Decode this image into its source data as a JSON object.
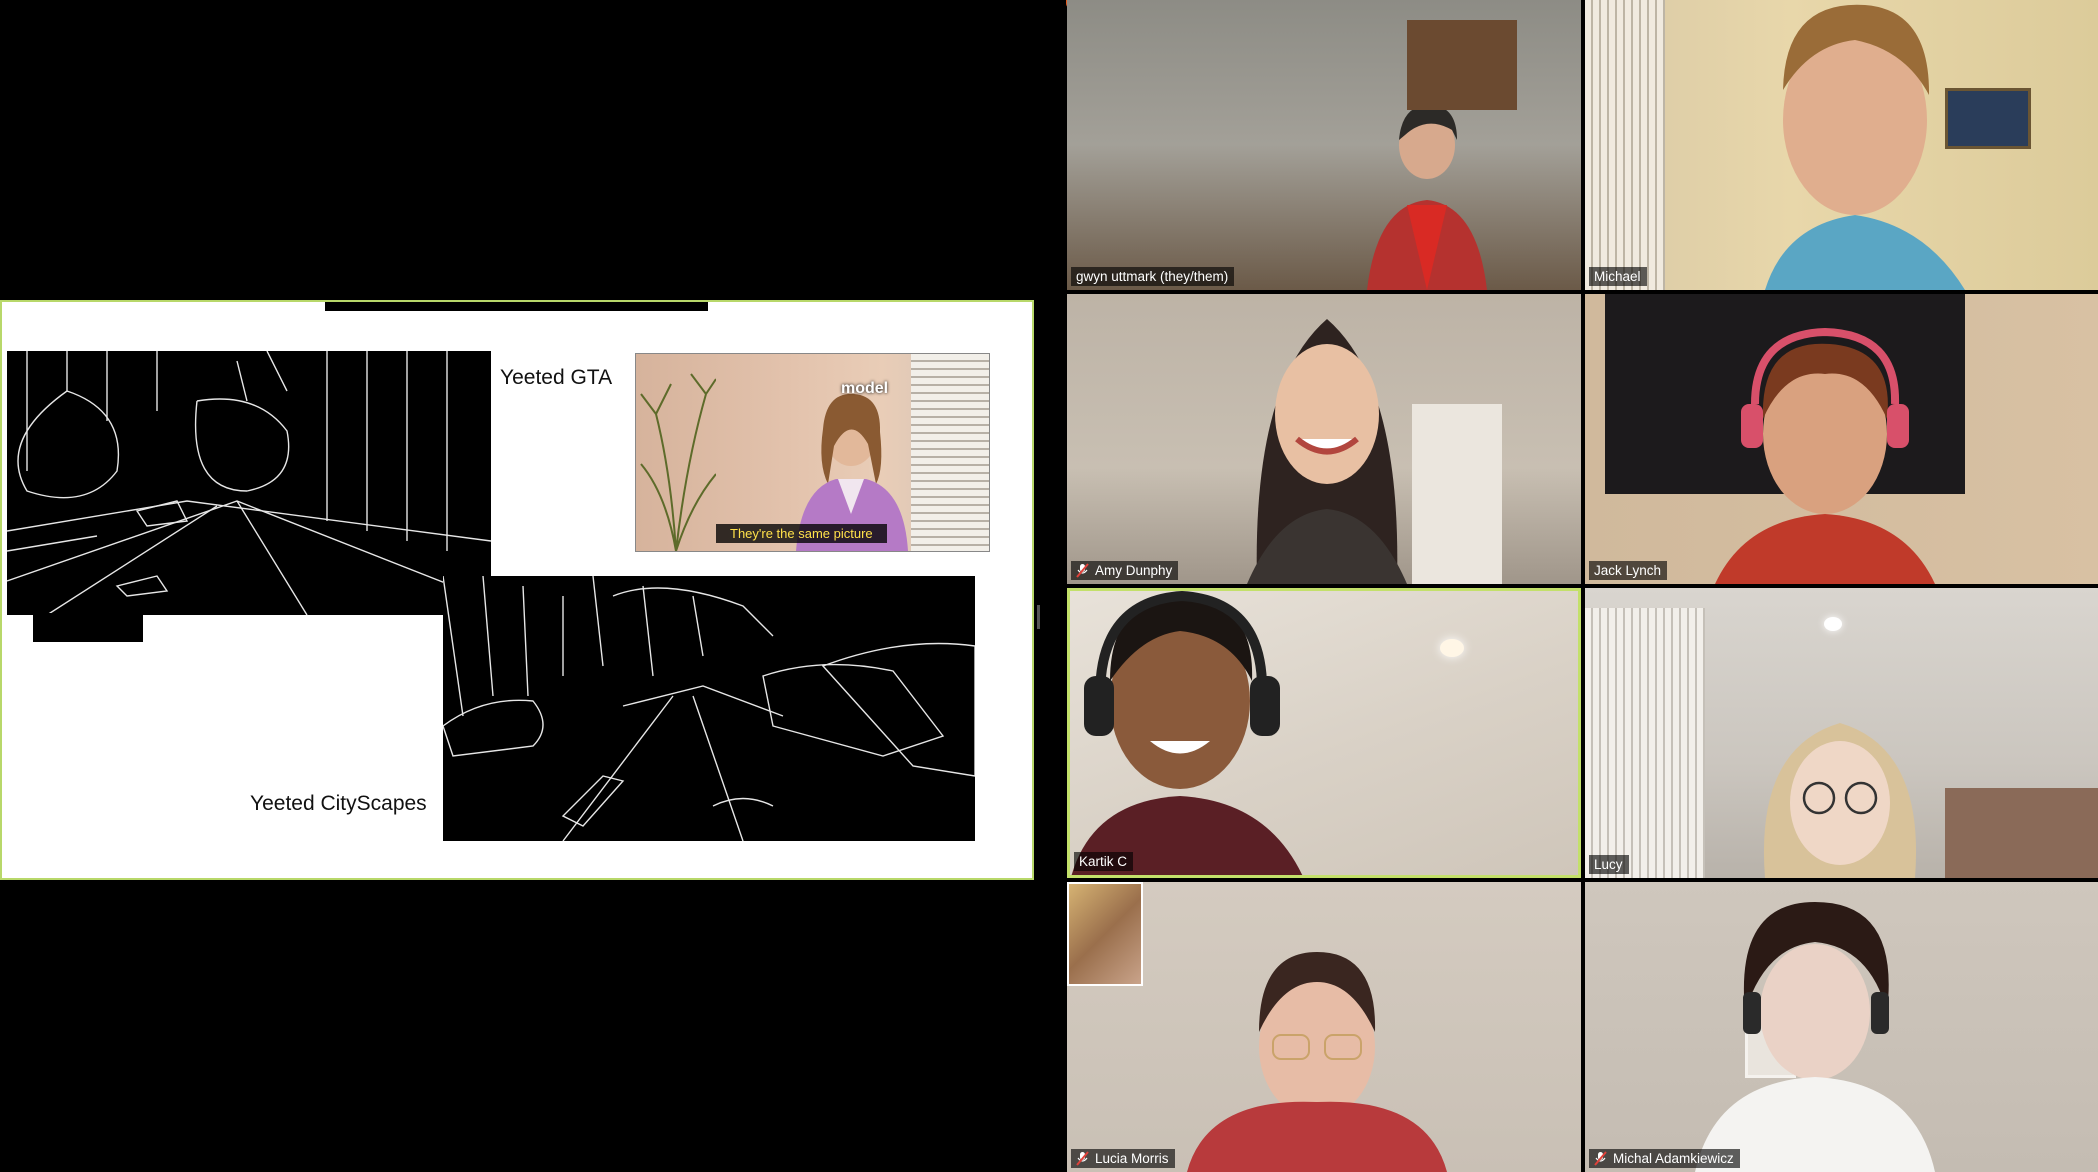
{
  "shared_screen": {
    "labels": {
      "gta": "Yeeted GTA",
      "cityscapes": "Yeeted CityScapes"
    },
    "office_meme": {
      "overlay_text": "model",
      "caption": "They're the same picture"
    }
  },
  "gallery": {
    "participants": [
      {
        "name": "gwyn uttmark (they/them)",
        "muted": false,
        "active": false
      },
      {
        "name": "Michael",
        "muted": false,
        "active": false
      },
      {
        "name": "Amy Dunphy",
        "muted": true,
        "active": false
      },
      {
        "name": "Jack Lynch",
        "muted": false,
        "active": false
      },
      {
        "name": "Kartik C",
        "muted": false,
        "active": true
      },
      {
        "name": "Lucy",
        "muted": false,
        "active": false
      },
      {
        "name": "Lucia Morris",
        "muted": true,
        "active": false
      },
      {
        "name": "Michal Adamkiewicz",
        "muted": true,
        "active": false
      }
    ]
  },
  "colors": {
    "active_speaker_border": "#c3e06a",
    "muted_icon": "#e0413a",
    "slide_border": "#b8d86a"
  },
  "icons": {
    "muted": "microphone-muted-icon"
  }
}
